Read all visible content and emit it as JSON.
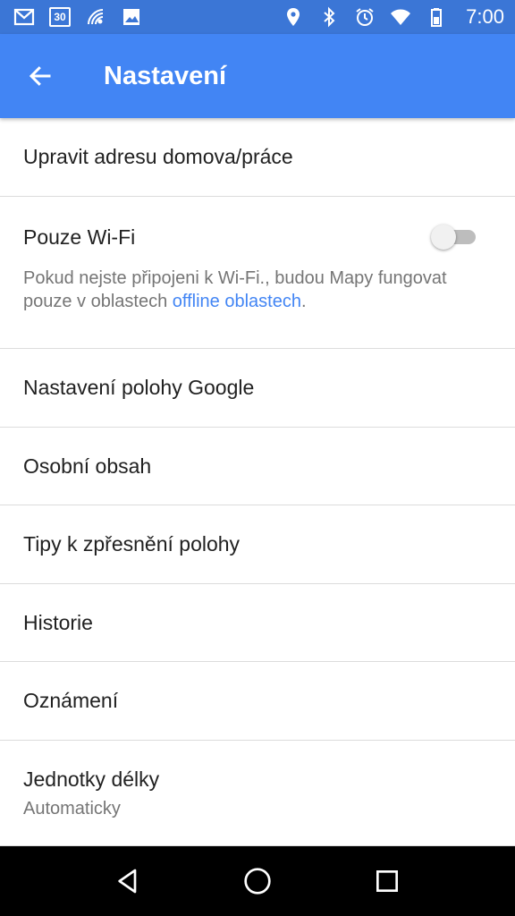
{
  "status_bar": {
    "time": "7:00",
    "calendar_day": "30",
    "icons_left": [
      "gmail-icon",
      "calendar-icon",
      "wifi-call-icon",
      "image-icon"
    ],
    "icons_right": [
      "location-icon",
      "bluetooth-icon",
      "alarm-icon",
      "wifi-icon",
      "battery-icon"
    ]
  },
  "app_bar": {
    "title": "Nastavení",
    "color": "#4285f4"
  },
  "settings": {
    "edit_address": "Upravit adresu domova/práce",
    "wifi_only": {
      "label": "Pouze Wi-Fi",
      "enabled": false,
      "description_prefix": "Pokud nejste připojeni k Wi-Fi., budou Mapy fungovat pouze v oblastech ",
      "description_link": "offline oblastech",
      "description_suffix": "."
    },
    "google_location": "Nastavení polohy Google",
    "personal_content": "Osobní obsah",
    "location_tips": "Tipy k zpřesnění polohy",
    "history": "Historie",
    "notifications": "Oznámení",
    "units": {
      "label": "Jednotky délky",
      "value": "Automaticky"
    }
  },
  "nav_bar": {
    "buttons": [
      "back-triangle-icon",
      "home-circle-icon",
      "recents-square-icon"
    ]
  }
}
